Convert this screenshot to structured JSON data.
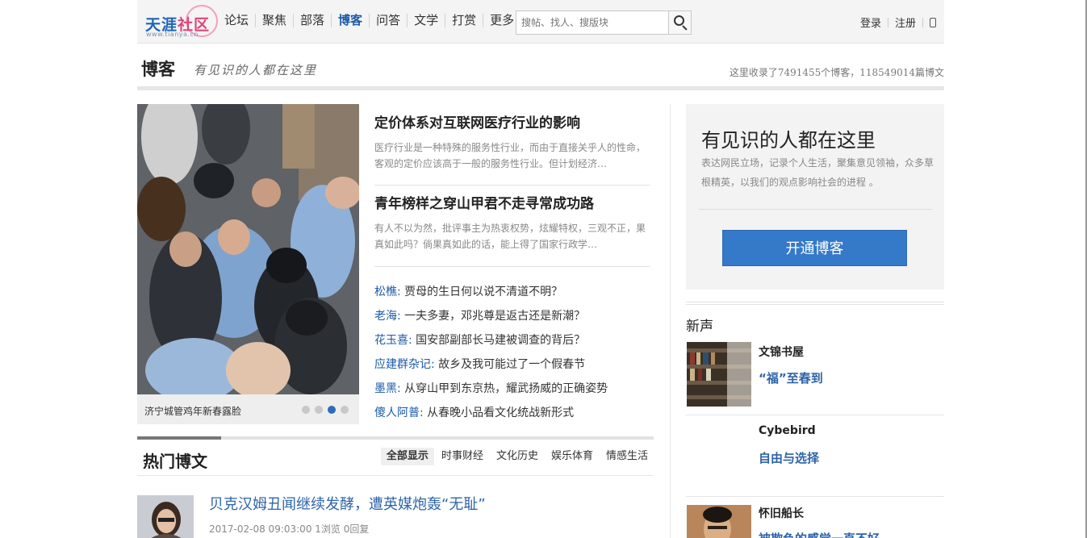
{
  "header": {
    "logo_text_1": "天涯",
    "logo_text_2": "社区",
    "logo_url": "www.tianya.cn",
    "nav": [
      "论坛",
      "聚焦",
      "部落",
      "博客",
      "问答",
      "文学",
      "打赏",
      "更多"
    ],
    "active_nav": "博客",
    "search_placeholder": "搜帖、找人、搜版块",
    "login": "登录",
    "register": "注册"
  },
  "channel": {
    "title": "博客",
    "slogan": "有见识的人都在这里",
    "stats": "这里收录了7491455个博客，118549014篇博文"
  },
  "hero": {
    "caption": "济宁城管鸡年新春露脸",
    "dots": 4,
    "active_dot": 3
  },
  "featured": [
    {
      "title": "定价体系对互联网医疗行业的影响",
      "summary": "医疗行业是一种特殊的服务性行业，而由于直接关乎人的性命，客观的定价应该高于一般的服务性行业。但计划经济…"
    },
    {
      "title": "青年榜样之穿山甲君不走寻常成功路",
      "summary": "有人不以为然，批评事主为热衷权势，炫耀特权，三观不正，果真如此吗？倘果真如此的话，能上得了国家行政学…"
    }
  ],
  "links": [
    {
      "author": "松樵:",
      "title": "贾母的生日何以说不清道不明？"
    },
    {
      "author": "老海:",
      "title": "一夫多妻，邓兆尊是返古还是新潮？"
    },
    {
      "author": "花玉喜:",
      "title": "国安部副部长马建被调查的背后？"
    },
    {
      "author": "应建群杂记:",
      "title": "故乡及我可能过了一个假春节"
    },
    {
      "author": "墨黑:",
      "title": "从穿山甲到东京热，耀武扬威的正确姿势"
    },
    {
      "author": "傻人阿普:",
      "title": "从春晚小品看文化统战新形式"
    }
  ],
  "hot": {
    "title": "热门博文",
    "tabs": [
      "全部显示",
      "时事财经",
      "文化历史",
      "娱乐体育",
      "情感生活"
    ],
    "active_tab": "全部显示",
    "posts": [
      {
        "title": "贝克汉姆丑闻继续发酵，遭英媒炮轰“无耻”",
        "meta": "2017-02-08 09:03:00 1浏览 0回复"
      }
    ]
  },
  "promo": {
    "title": "有见识的人都在这里",
    "desc": "表达网民立场，记录个人生活，聚集意见领袖，众多草根精英，以我们的观点影响社会的进程 。",
    "button": "开通博客"
  },
  "sidebar": {
    "section_title": "新声",
    "bloggers": [
      {
        "name": "文锦书屋",
        "post": "“福”至春到"
      },
      {
        "name": "Cybebird",
        "post": "自由与选择"
      },
      {
        "name": "怀旧船长",
        "post": "被欺负的感觉一直不好"
      }
    ]
  },
  "colors": {
    "link_blue": "#1d5aa8",
    "button_blue": "#3579c9",
    "logo_pink": "#e0457a"
  }
}
